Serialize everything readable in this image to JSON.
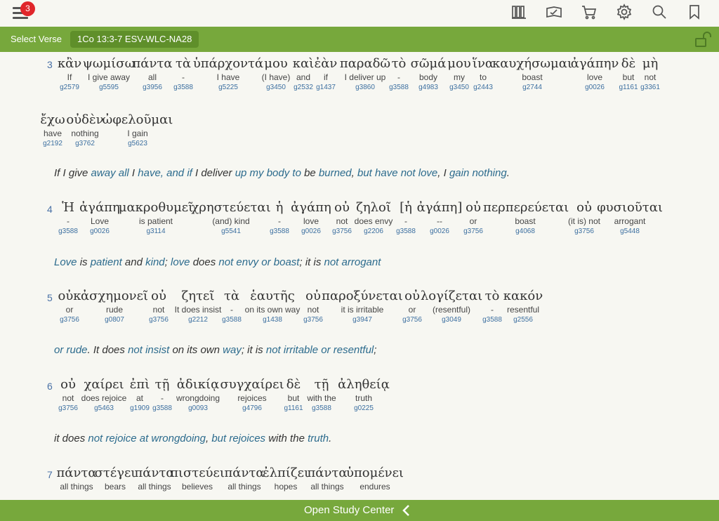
{
  "toolbar": {
    "badge": "3",
    "icons": [
      "library-icon",
      "reading-plan-icon",
      "cart-icon",
      "gear-icon",
      "search-icon",
      "bookmark-icon"
    ]
  },
  "versebar": {
    "select_label": "Select Verse",
    "reference": "1Co 13:3-7 ESV-WLC-NA28"
  },
  "bottom": {
    "label": "Open Study Center"
  },
  "colors": {
    "green": "#77a83c",
    "badge": "#e0262b",
    "highlight": "#2c6b8d",
    "strong": "#3c6fa0"
  },
  "verses": [
    {
      "number": "3",
      "lines": [
        [
          {
            "gk": "κἂν",
            "gl": "If",
            "s": "g2579"
          },
          {
            "gk": "ψωμίσω",
            "gl": "I give away",
            "s": "g5595"
          },
          {
            "gk": "πάντα",
            "gl": "all",
            "s": "g3956"
          },
          {
            "gk": "τὰ",
            "gl": "-",
            "s": "g3588"
          },
          {
            "gk": "ὑπάρχοντά",
            "gl": "I have",
            "s": "g5225"
          },
          {
            "gk": "μου",
            "gl": "(I have)",
            "s": "g3450"
          },
          {
            "gk": "καὶ",
            "gl": "and",
            "s": "g2532"
          },
          {
            "gk": "ἐὰν",
            "gl": "if",
            "s": "g1437"
          },
          {
            "gk": "παραδῶ",
            "gl": "I deliver up",
            "s": "g3860"
          },
          {
            "gk": "τὸ",
            "gl": "-",
            "s": "g3588"
          },
          {
            "gk": "σῶμά",
            "gl": "body",
            "s": "g4983"
          },
          {
            "gk": "μου",
            "gl": "my",
            "s": "g3450"
          },
          {
            "gk": "ἵνα",
            "gl": "to",
            "s": "g2443"
          },
          {
            "gk": "καυχήσωμαι",
            "gl": "boast",
            "s": "g2744"
          },
          {
            "gk": "ἀγάπην",
            "gl": "love",
            "s": "g0026"
          },
          {
            "gk": "δὲ",
            "gl": "but",
            "s": "g1161"
          },
          {
            "gk": "μὴ",
            "gl": "not",
            "s": "g3361"
          }
        ],
        [
          {
            "gk": "ἔχω",
            "gl": "have",
            "s": "g2192"
          },
          {
            "gk": "οὐδὲν",
            "gl": "nothing",
            "s": "g3762"
          },
          {
            "gk": "ὠφελοῦμαι",
            "gl": "I gain",
            "s": "g5623"
          }
        ]
      ],
      "english": [
        {
          "t": "If ",
          "h": false
        },
        {
          "t": "I give ",
          "h": false
        },
        {
          "t": "away all",
          "h": true
        },
        {
          "t": " I ",
          "h": false
        },
        {
          "t": "have, and if",
          "h": true
        },
        {
          "t": " I deliver ",
          "h": false
        },
        {
          "t": "up my body to",
          "h": true
        },
        {
          "t": " be ",
          "h": false
        },
        {
          "t": "burned",
          "h": true
        },
        {
          "t": ", ",
          "h": false
        },
        {
          "t": "but have not love",
          "h": true
        },
        {
          "t": ", I ",
          "h": false
        },
        {
          "t": "gain nothing",
          "h": true
        },
        {
          "t": ".",
          "h": false
        }
      ]
    },
    {
      "number": "4",
      "lines": [
        [
          {
            "gk": "Ἡ",
            "gl": "-",
            "s": "g3588"
          },
          {
            "gk": "ἀγάπη",
            "gl": "Love",
            "s": "g0026"
          },
          {
            "gk": "μακροθυμεῖ",
            "gl": "is patient",
            "s": "g3114"
          },
          {
            "gk": "χρηστεύεται",
            "gl": "(and) kind",
            "s": "g5541"
          },
          {
            "gk": "ἡ",
            "gl": "-",
            "s": "g3588"
          },
          {
            "gk": "ἀγάπη",
            "gl": "love",
            "s": "g0026"
          },
          {
            "gk": "οὐ",
            "gl": "not",
            "s": "g3756"
          },
          {
            "gk": "ζηλοῖ",
            "gl": "does envy",
            "s": "g2206"
          },
          {
            "gk": "[ἡ",
            "gl": "-",
            "s": "g3588"
          },
          {
            "gk": "ἀγάπη]",
            "gl": "--",
            "s": "g0026"
          },
          {
            "gk": "οὐ",
            "gl": "or",
            "s": "g3756"
          },
          {
            "gk": "περπερεύεται",
            "gl": "boast",
            "s": "g4068"
          },
          {
            "gk": "οὐ",
            "gl": "(it is) not",
            "s": "g3756"
          },
          {
            "gk": "φυσιοῦται",
            "gl": "arrogant",
            "s": "g5448"
          }
        ]
      ],
      "english": [
        {
          "t": "Love",
          "h": true
        },
        {
          "t": " is ",
          "h": false
        },
        {
          "t": "patient",
          "h": true
        },
        {
          "t": " and ",
          "h": false
        },
        {
          "t": "kind",
          "h": true
        },
        {
          "t": "; ",
          "h": false
        },
        {
          "t": "love",
          "h": true
        },
        {
          "t": " does ",
          "h": false
        },
        {
          "t": "not envy or boast",
          "h": true
        },
        {
          "t": "; it is ",
          "h": false
        },
        {
          "t": "not arrogant",
          "h": true
        }
      ]
    },
    {
      "number": "5",
      "lines": [
        [
          {
            "gk": "οὐκ",
            "gl": "or",
            "s": "g3756"
          },
          {
            "gk": "ἀσχημονεῖ",
            "gl": "rude",
            "s": "g0807"
          },
          {
            "gk": "οὐ",
            "gl": "not",
            "s": "g3756"
          },
          {
            "gk": "ζητεῖ",
            "gl": "It does insist",
            "s": "g2212"
          },
          {
            "gk": "τὰ",
            "gl": "-",
            "s": "g3588"
          },
          {
            "gk": "ἑαυτῆς",
            "gl": "on its own way",
            "s": "g1438"
          },
          {
            "gk": "οὐ",
            "gl": "not",
            "s": "g3756"
          },
          {
            "gk": "παροξύνεται",
            "gl": "it is irritable",
            "s": "g3947"
          },
          {
            "gk": "οὐ",
            "gl": "or",
            "s": "g3756"
          },
          {
            "gk": "λογίζεται",
            "gl": "(resentful)",
            "s": "g3049"
          },
          {
            "gk": "τὸ",
            "gl": "-",
            "s": "g3588"
          },
          {
            "gk": "κακόν",
            "gl": "resentful",
            "s": "g2556"
          }
        ]
      ],
      "english": [
        {
          "t": "or rude",
          "h": true
        },
        {
          "t": ". It does ",
          "h": false
        },
        {
          "t": "not insist",
          "h": true
        },
        {
          "t": " on its own ",
          "h": false
        },
        {
          "t": "way",
          "h": true
        },
        {
          "t": "; it is ",
          "h": false
        },
        {
          "t": "not irritable or resentful",
          "h": true
        },
        {
          "t": ";",
          "h": false
        }
      ]
    },
    {
      "number": "6",
      "lines": [
        [
          {
            "gk": "οὐ",
            "gl": "not",
            "s": "g3756"
          },
          {
            "gk": "χαίρει",
            "gl": "does rejoice",
            "s": "g5463"
          },
          {
            "gk": "ἐπὶ",
            "gl": "at",
            "s": "g1909"
          },
          {
            "gk": "τῇ",
            "gl": "-",
            "s": "g3588"
          },
          {
            "gk": "ἀδικίᾳ",
            "gl": "wrongdoing",
            "s": "g0093"
          },
          {
            "gk": "συγχαίρει",
            "gl": "rejoices",
            "s": "g4796"
          },
          {
            "gk": "δὲ",
            "gl": "but",
            "s": "g1161"
          },
          {
            "gk": "τῇ",
            "gl": "with the",
            "s": "g3588"
          },
          {
            "gk": "ἀληθείᾳ",
            "gl": "truth",
            "s": "g0225"
          }
        ]
      ],
      "english": [
        {
          "t": "it does ",
          "h": false
        },
        {
          "t": "not rejoice at wrongdoing",
          "h": true
        },
        {
          "t": ", ",
          "h": false
        },
        {
          "t": "but rejoices",
          "h": true
        },
        {
          "t": " with the ",
          "h": false
        },
        {
          "t": "truth",
          "h": true
        },
        {
          "t": ".",
          "h": false
        }
      ]
    },
    {
      "number": "7",
      "lines": [
        [
          {
            "gk": "πάντα",
            "gl": "all things",
            "s": ""
          },
          {
            "gk": "στέγει",
            "gl": "bears",
            "s": ""
          },
          {
            "gk": "πάντα",
            "gl": "all things",
            "s": ""
          },
          {
            "gk": "πιστεύει",
            "gl": "believes",
            "s": ""
          },
          {
            "gk": "πάντα",
            "gl": "all things",
            "s": ""
          },
          {
            "gk": "ἐλπίζει",
            "gl": "hopes",
            "s": ""
          },
          {
            "gk": "πάντα",
            "gl": "all things",
            "s": ""
          },
          {
            "gk": "ὑπομένει",
            "gl": "endures",
            "s": ""
          }
        ]
      ],
      "english": []
    }
  ]
}
